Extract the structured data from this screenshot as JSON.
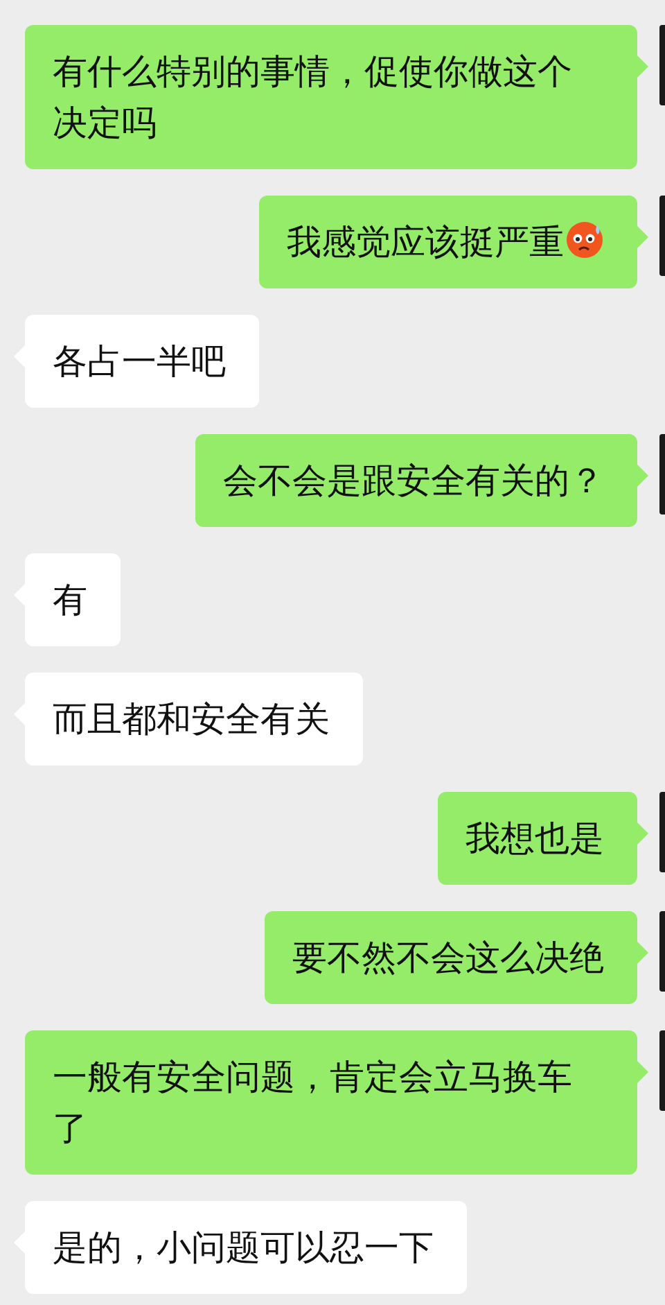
{
  "messages": [
    {
      "kind": "sent",
      "text": "有什么特别的事情，促使你做这个决定吗",
      "emoji": false
    },
    {
      "kind": "sent",
      "text": "我感觉应该挺严重",
      "emoji": true
    },
    {
      "kind": "received",
      "text": "各占一半吧",
      "emoji": false
    },
    {
      "kind": "sent",
      "text": "会不会是跟安全有关的？",
      "emoji": false
    },
    {
      "kind": "received",
      "text": "有",
      "emoji": false
    },
    {
      "kind": "received",
      "text": "而且都和安全有关",
      "emoji": false
    },
    {
      "kind": "sent",
      "text": "我想也是",
      "emoji": false
    },
    {
      "kind": "sent",
      "text": "要不然不会这么决绝",
      "emoji": false
    },
    {
      "kind": "sent",
      "text": "一般有安全问题，肯定会立马换车了",
      "emoji": false
    },
    {
      "kind": "received",
      "text": "是的，小问题可以忍一下",
      "emoji": false
    }
  ]
}
